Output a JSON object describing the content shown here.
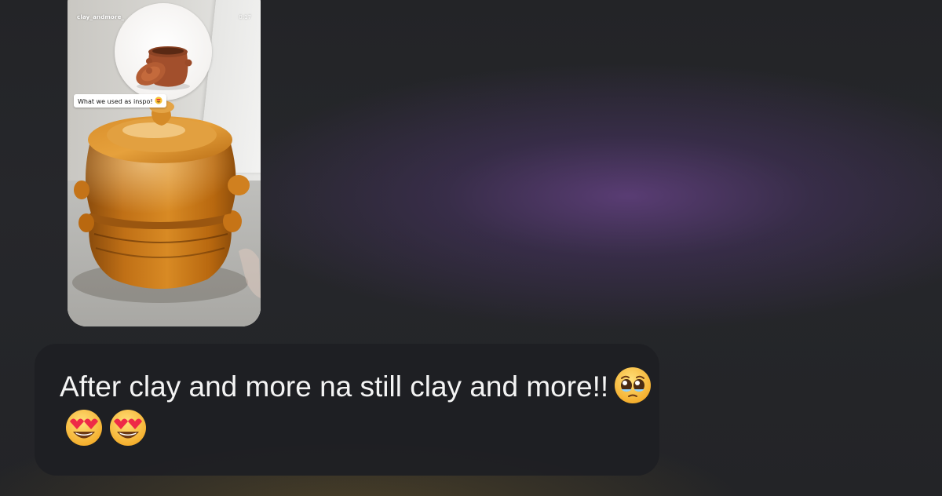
{
  "story": {
    "username": "clay_andmore_",
    "time": "0:17",
    "caption": "What we used as inspo!",
    "caption_emoji": "heart-eyes-emoji"
  },
  "message": {
    "text": "After clay and more na still clay and more!!",
    "emojis": [
      "pleading-face-emoji",
      "heart-eyes-emoji",
      "heart-eyes-emoji"
    ]
  },
  "colors": {
    "background": "#232427",
    "bubble": "#1e1f23",
    "accent_glow": "#5e3f7e",
    "pot_orange": "#c8781a",
    "inspo_pot": "#a5532f",
    "text": "#f4f4f4"
  }
}
